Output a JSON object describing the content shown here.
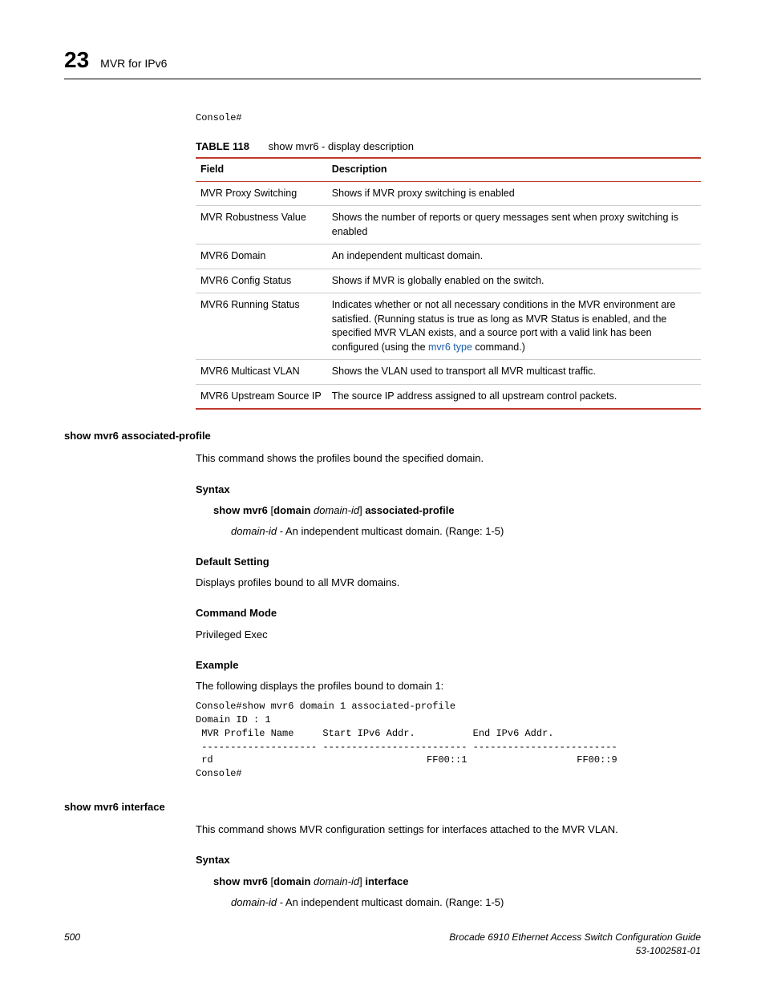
{
  "header": {
    "chapter_number": "23",
    "chapter_title": "MVR for IPv6"
  },
  "console_top": "Console#",
  "table": {
    "label": "TABLE 118",
    "title": "show mvr6 - display description",
    "head_field": "Field",
    "head_desc": "Description",
    "rows": [
      {
        "field": "MVR Proxy Switching",
        "desc": "Shows if MVR proxy switching is enabled"
      },
      {
        "field": "MVR Robustness Value",
        "desc": "Shows the number of reports or query messages sent when proxy switching is enabled"
      },
      {
        "field": "MVR6 Domain",
        "desc": "An independent multicast domain."
      },
      {
        "field": "MVR6 Config Status",
        "desc": "Shows if MVR is globally enabled on the switch."
      },
      {
        "field": "MVR6 Running Status",
        "desc_pre": "Indicates whether or not all necessary conditions in the MVR environment are satisfied. (Running status is true as long as MVR Status is enabled, and the specified MVR VLAN exists, and a source port with a valid link has been configured (using the ",
        "link": "mvr6 type",
        "desc_post": " command.)"
      },
      {
        "field": "MVR6 Multicast VLAN",
        "desc": "Shows the VLAN used to transport all MVR multicast traffic."
      },
      {
        "field": "MVR6 Upstream Source IP",
        "desc": "The source IP address assigned to all upstream control packets."
      }
    ]
  },
  "sec1": {
    "title": "show mvr6 associated-profile",
    "intro": "This command shows the profiles bound the specified domain.",
    "syntax_h": "Syntax",
    "syntax_cmd_pre": "show mvr6 ",
    "syntax_cmd_mid1": "[",
    "syntax_cmd_bold2": "domain ",
    "syntax_cmd_italic": "domain-id",
    "syntax_cmd_mid2": "] ",
    "syntax_cmd_bold3": "associated-profile",
    "syntax_desc_italic": "domain-id",
    "syntax_desc_rest": " - An independent multicast domain. (Range: 1-5)",
    "default_h": "Default Setting",
    "default_text": "Displays profiles bound to all MVR domains.",
    "mode_h": "Command Mode",
    "mode_text": "Privileged Exec",
    "example_h": "Example",
    "example_text": "The following displays the profiles bound to domain 1:",
    "example_console": "Console#show mvr6 domain 1 associated-profile\nDomain ID : 1\n MVR Profile Name     Start IPv6 Addr.          End IPv6 Addr.\n -------------------- ------------------------- -------------------------\n rd                                     FF00::1                   FF00::9\nConsole#"
  },
  "sec2": {
    "title": "show mvr6 interface",
    "intro": "This command shows MVR configuration settings for interfaces attached to the MVR VLAN.",
    "syntax_h": "Syntax",
    "syntax_cmd_pre": "show mvr6 ",
    "syntax_cmd_mid1": "[",
    "syntax_cmd_bold2": "domain ",
    "syntax_cmd_italic": "domain-id",
    "syntax_cmd_mid2": "] ",
    "syntax_cmd_bold3": "interface",
    "syntax_desc_italic": "domain-id",
    "syntax_desc_rest": " - An independent multicast domain. (Range: 1-5)"
  },
  "footer": {
    "page": "500",
    "doc_title": "Brocade 6910 Ethernet Access Switch Configuration Guide",
    "doc_num": "53-1002581-01"
  }
}
